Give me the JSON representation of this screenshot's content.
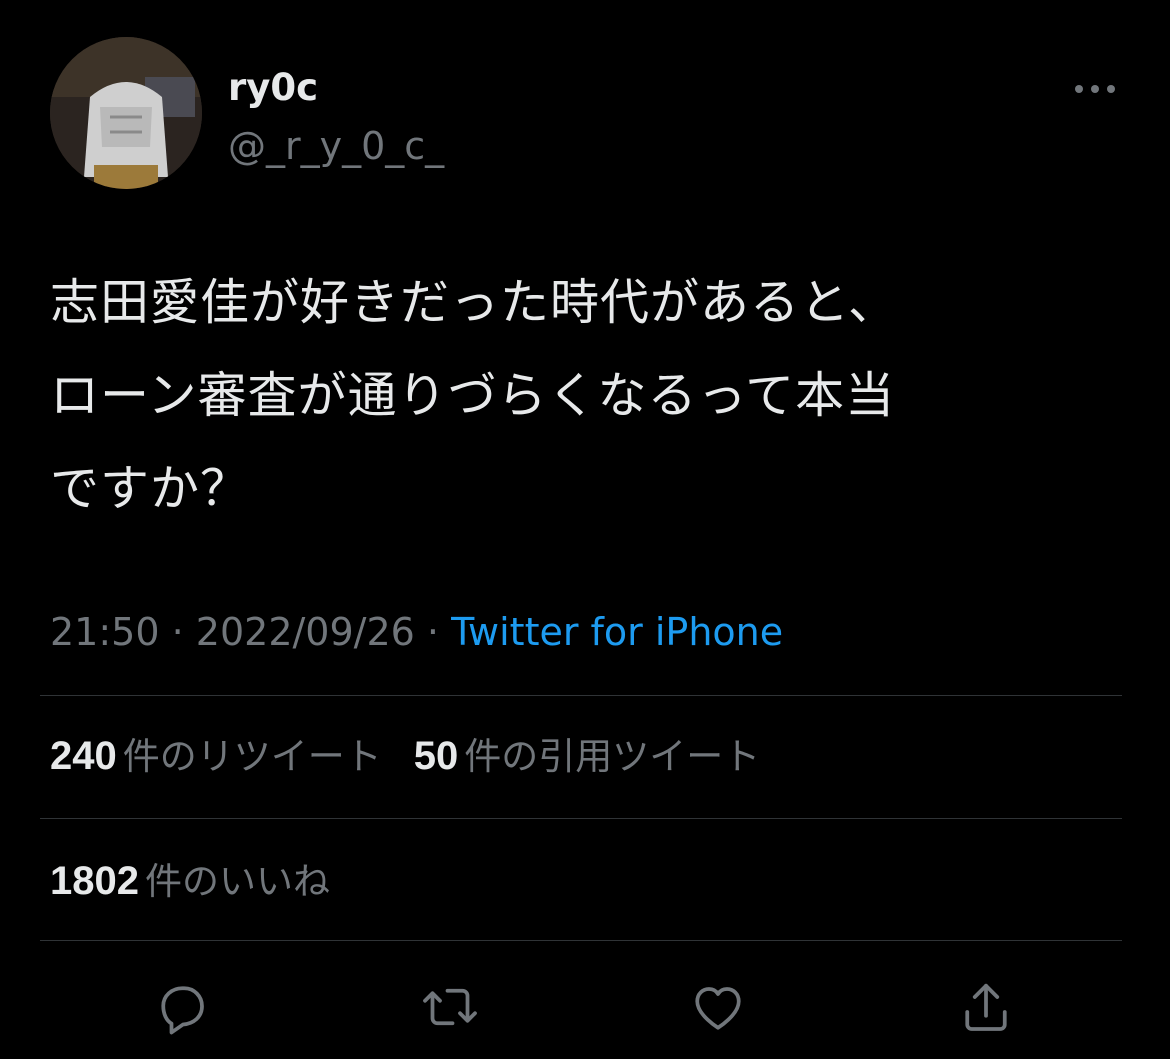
{
  "user": {
    "display_name": "ry0c",
    "handle": "@_r_y_0_c_"
  },
  "tweet": {
    "text": "志田愛佳が好きだった時代があると、\nローン審査が通りづらくなるって本当\nですか？",
    "time": "21:50",
    "date": "2022/09/26",
    "separator": "·",
    "source": "Twitter for iPhone"
  },
  "stats": {
    "retweets_count": "240",
    "retweets_label": "件のリツイート",
    "quotes_count": "50",
    "quotes_label": "件の引用ツイート",
    "likes_count": "1802",
    "likes_label": "件のいいね"
  },
  "actions": {
    "reply_icon": "reply-icon",
    "retweet_icon": "retweet-icon",
    "like_icon": "heart-icon",
    "share_icon": "share-icon"
  },
  "colors": {
    "background": "#000000",
    "text": "#e7e9ea",
    "secondary": "#71767b",
    "link": "#1d9bf0",
    "divider": "#2f3336"
  }
}
